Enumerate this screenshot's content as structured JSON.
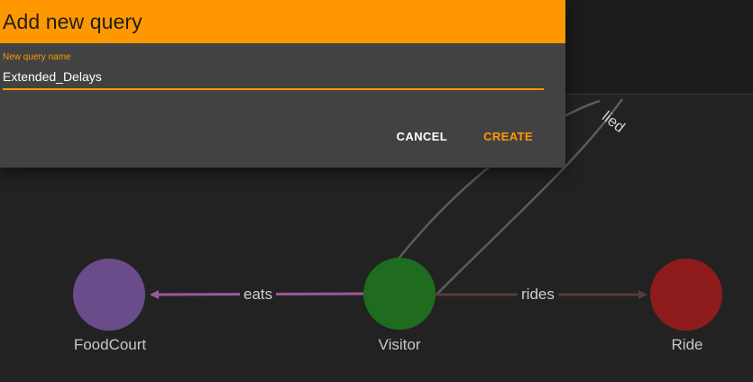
{
  "dialog": {
    "title": "Add new query",
    "field_label": "New query name",
    "field_value": "Extended_Delays",
    "cancel_label": "CANCEL",
    "create_label": "CREATE"
  },
  "graph": {
    "nodes": [
      {
        "id": "foodcourt",
        "label": "FoodCourt",
        "color": "#6a4c8a"
      },
      {
        "id": "visitor",
        "label": "Visitor",
        "color": "#1f6b1f"
      },
      {
        "id": "ride",
        "label": "Ride",
        "color": "#8e1c1c"
      }
    ],
    "edges": [
      {
        "id": "eats",
        "label": "eats",
        "color": "#9a5a98"
      },
      {
        "id": "rides",
        "label": "rides",
        "color": "#5a3a36"
      },
      {
        "id": "partial",
        "label": "lied",
        "color": "#5c5c5c"
      }
    ]
  },
  "colors": {
    "accent": "#ff9800",
    "background": "#222222",
    "dialog": "#424242"
  }
}
